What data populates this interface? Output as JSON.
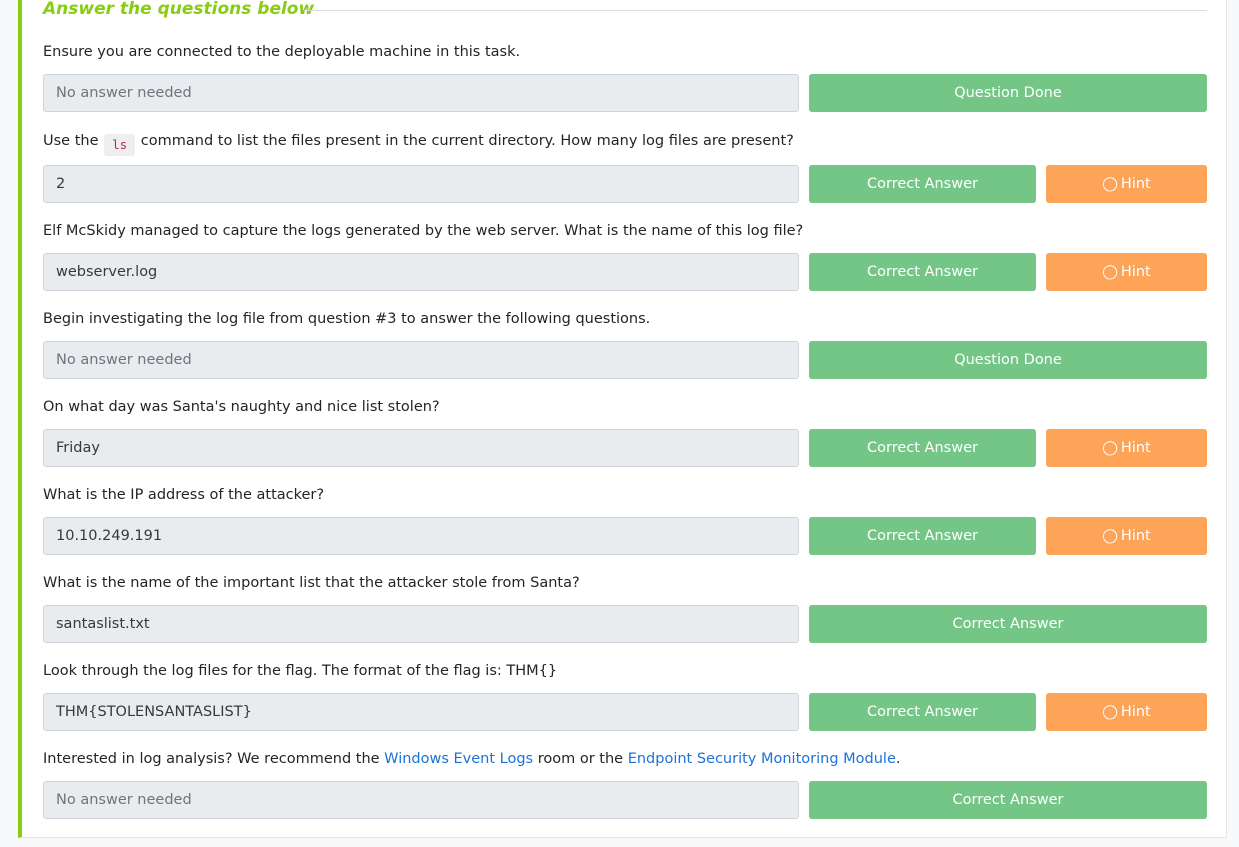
{
  "header": {
    "title": "Answer the questions below"
  },
  "labels": {
    "question_done": "Question Done",
    "correct_answer": "Correct Answer",
    "hint": "Hint"
  },
  "colors": {
    "accent": "#88cc14",
    "success": "#74c686",
    "hint": "#fda459",
    "link": "#1a73d9"
  },
  "questions": [
    {
      "text": "Ensure you are connected to the deployable machine in this task.",
      "answer": "No answer needed",
      "placeholder": true,
      "status": "Question Done",
      "hint": false
    },
    {
      "text_before": "Use the",
      "code": "ls",
      "text_after": "command to list the files present in the current directory. How many log files are present?",
      "answer": "2",
      "placeholder": false,
      "status": "Correct Answer",
      "hint": true
    },
    {
      "text": "Elf McSkidy managed to capture the logs generated by the web server. What is the name of this log file?",
      "answer": "webserver.log",
      "placeholder": false,
      "status": "Correct Answer",
      "hint": true
    },
    {
      "text": "Begin investigating the log file from question #3 to answer the following questions.",
      "answer": "No answer needed",
      "placeholder": true,
      "status": "Question Done",
      "hint": false
    },
    {
      "text": "On what day was Santa's naughty and nice list stolen?",
      "answer": "Friday",
      "placeholder": false,
      "status": "Correct Answer",
      "hint": true
    },
    {
      "text": "What is the IP address of the attacker?",
      "answer": "10.10.249.191",
      "placeholder": false,
      "status": "Correct Answer",
      "hint": true
    },
    {
      "text": "What is the name of the important list that the attacker stole from Santa?",
      "answer": "santaslist.txt",
      "placeholder": false,
      "status": "Correct Answer",
      "hint": false
    },
    {
      "text": "Look through the log files for the flag. The format of the flag is: THM{}",
      "answer": "THM{STOLENSANTASLIST}",
      "placeholder": false,
      "status": "Correct Answer",
      "hint": true
    },
    {
      "text_before": "Interested in log analysis? We recommend the",
      "link1": "Windows Event Logs",
      "text_middle": "room or the",
      "link2": "Endpoint Security Monitoring Module",
      "text_end": ".",
      "answer": "No answer needed",
      "placeholder": true,
      "status": "Correct Answer",
      "hint": false
    }
  ]
}
